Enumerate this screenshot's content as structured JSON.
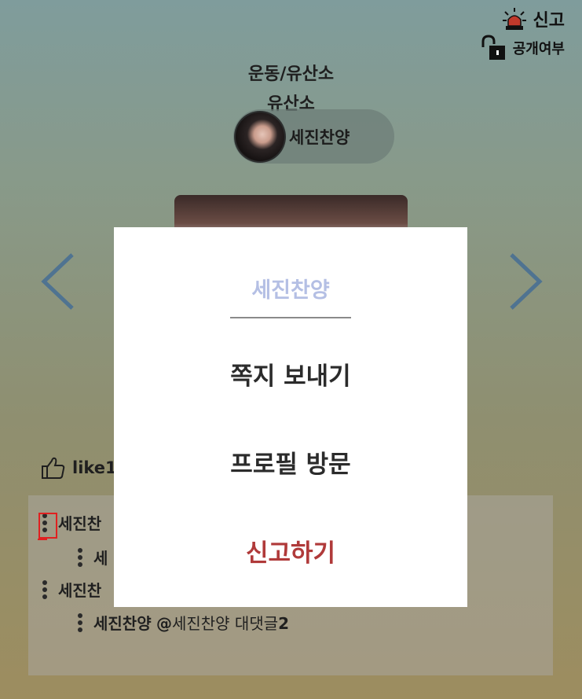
{
  "header": {
    "report_label": "신고",
    "privacy_label": "공개여부"
  },
  "post": {
    "category": "운동/유산소",
    "subcategory": "유산소",
    "author": "세진찬양",
    "like_label": "like1"
  },
  "comments": [
    {
      "author": "세진찬",
      "text": ""
    },
    {
      "author": "세",
      "text": ""
    },
    {
      "author": "세진찬",
      "text": ""
    },
    {
      "author": "세진찬양",
      "mention": "@",
      "text": "세진찬양 대댓글",
      "suffix": "2"
    }
  ],
  "modal": {
    "title": "세진찬양",
    "items": {
      "message": "쪽지 보내기",
      "visit_profile": "프로필 방문",
      "report": "신고하기"
    }
  },
  "icons": {
    "siren": "siren-icon",
    "lock": "unlocked-lock-icon",
    "thumbs_up": "thumbs-up-icon",
    "prev": "chevron-left-icon",
    "next": "chevron-right-icon",
    "kebab": "kebab-menu-icon"
  },
  "colors": {
    "modal_title": "#b4bfe4",
    "report_item": "#b03a3a",
    "arrow": "#4f7391",
    "highlight": "#e02020"
  }
}
